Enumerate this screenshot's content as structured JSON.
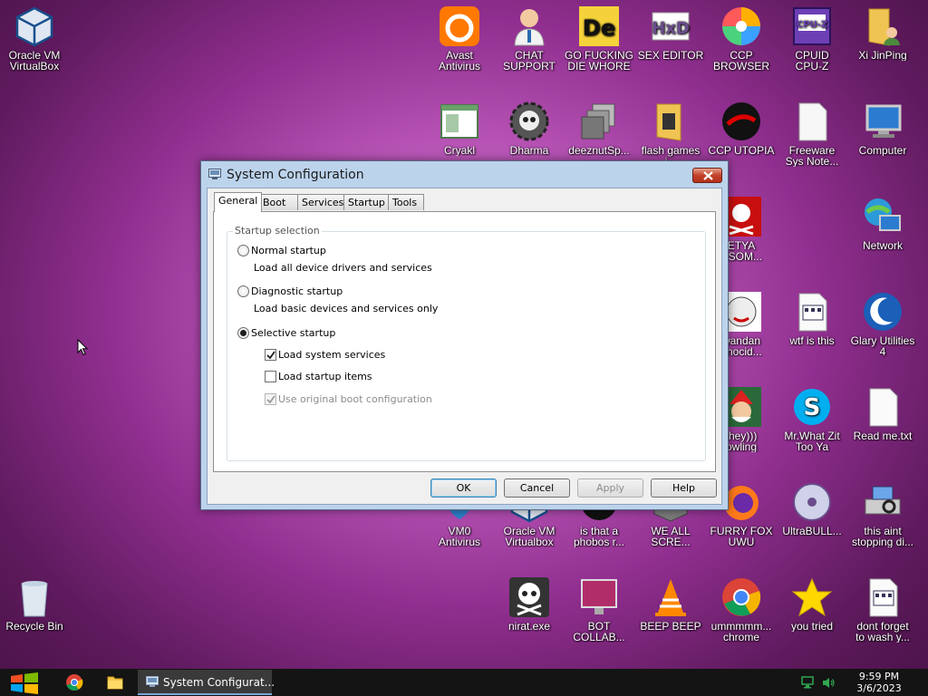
{
  "desktop_icons": [
    {
      "id": "virtualbox",
      "label": "Oracle VM\nVirtualBox",
      "icon": "virtualbox-icon"
    },
    {
      "id": "avast",
      "label": "Avast\nAntivirus",
      "icon": "avast-icon"
    },
    {
      "id": "chat-support",
      "label": "CHAT\nSUPPORT",
      "icon": "doctor-icon"
    },
    {
      "id": "go-die",
      "label": "GO FUCKING\nDIE WHORE",
      "icon": "de-icon"
    },
    {
      "id": "sex-editor",
      "label": "SEX EDITOR",
      "icon": "hxd-icon"
    },
    {
      "id": "ccp-browser",
      "label": "CCP\nBROWSER",
      "icon": "pinwheel-icon"
    },
    {
      "id": "cpuid",
      "label": "CPUID\nCPU-Z",
      "icon": "cpuz-icon"
    },
    {
      "id": "xi-jinping",
      "label": "Xi JinPing",
      "icon": "folder-user-icon"
    },
    {
      "id": "cryakl",
      "label": "Cryakl",
      "icon": "window-icon"
    },
    {
      "id": "dharma",
      "label": "Dharma",
      "icon": "skull-gear-icon"
    },
    {
      "id": "deeznut",
      "label": "deeznutSp...",
      "icon": "stack-icon"
    },
    {
      "id": "flash-games",
      "label": "flash games i...",
      "icon": "folder-icon"
    },
    {
      "id": "ccp-utopia",
      "label": "CCP UTOPIA",
      "icon": "red-dark-icon"
    },
    {
      "id": "freeware",
      "label": "Freeware\nSys Note...",
      "icon": "document-icon"
    },
    {
      "id": "computer",
      "label": "Computer",
      "icon": "computer-icon"
    },
    {
      "id": "petya",
      "label": "ETYA\nNSOM...",
      "icon": "skull-red-icon"
    },
    {
      "id": "network",
      "label": "Network",
      "icon": "network-icon"
    },
    {
      "id": "rwandan",
      "label": "wandan\nenocid...",
      "icon": "face-icon"
    },
    {
      "id": "wtf",
      "label": "wtf is this",
      "icon": "calendar-doc-icon"
    },
    {
      "id": "glary",
      "label": "Glary Utilities\n4",
      "icon": "moon-icon"
    },
    {
      "id": "they",
      "label": "they)))\nowling",
      "icon": "santa-icon"
    },
    {
      "id": "mr-what",
      "label": "Mr.What Zit\nToo Ya",
      "icon": "skype-icon"
    },
    {
      "id": "readme",
      "label": "Read me.txt",
      "icon": "text-file-icon"
    },
    {
      "id": "vm0",
      "label": "VM0\nAntivirus",
      "icon": "shield-icon"
    },
    {
      "id": "oracle-vm2",
      "label": "Oracle VM\nVirtualbox",
      "icon": "virtualbox-icon"
    },
    {
      "id": "phobos",
      "label": "is that a\nphobos r...",
      "icon": "alien-icon"
    },
    {
      "id": "we-all",
      "label": "WE ALL\nSCRE...",
      "icon": "box-icon"
    },
    {
      "id": "furry-fox",
      "label": "FURRY FOX\nUWU",
      "icon": "firefox-icon"
    },
    {
      "id": "ultrabull",
      "label": "UltraBULL...",
      "icon": "disc-icon"
    },
    {
      "id": "this-aint",
      "label": "this aint\nstopping di...",
      "icon": "scanner-icon"
    },
    {
      "id": "recycle",
      "label": "Recycle Bin",
      "icon": "recycle-bin-icon"
    },
    {
      "id": "nirat",
      "label": "nirat.exe",
      "icon": "skull-icon"
    },
    {
      "id": "bot-collab",
      "label": "BOT\nCOLLAB...",
      "icon": "monitor-red-icon"
    },
    {
      "id": "beep",
      "label": "BEEP BEEP",
      "icon": "vlc-icon"
    },
    {
      "id": "chrome",
      "label": "ummmmm...\nchrome",
      "icon": "chrome-icon"
    },
    {
      "id": "you-tried",
      "label": "you tried",
      "icon": "star-icon"
    },
    {
      "id": "dont-forget",
      "label": "dont forget\nto wash y...",
      "icon": "calendar-doc-icon"
    }
  ],
  "dialog": {
    "title": "System Configuration",
    "tabs": [
      "General",
      "Boot",
      "Services",
      "Startup",
      "Tools"
    ],
    "group_label": "Startup selection",
    "options": {
      "normal": {
        "label": "Normal startup",
        "desc": "Load all device drivers and services"
      },
      "diagnostic": {
        "label": "Diagnostic startup",
        "desc": "Load basic devices and services only"
      },
      "selective": {
        "label": "Selective startup"
      }
    },
    "checkboxes": {
      "system_services": "Load system services",
      "startup_items": "Load startup items",
      "original_boot": "Use original boot configuration"
    },
    "buttons": {
      "ok": "OK",
      "cancel": "Cancel",
      "apply": "Apply",
      "help": "Help"
    }
  },
  "taskbar": {
    "task_label": "System Configurat...",
    "time": "9:59 PM",
    "date": "3/6/2023"
  }
}
